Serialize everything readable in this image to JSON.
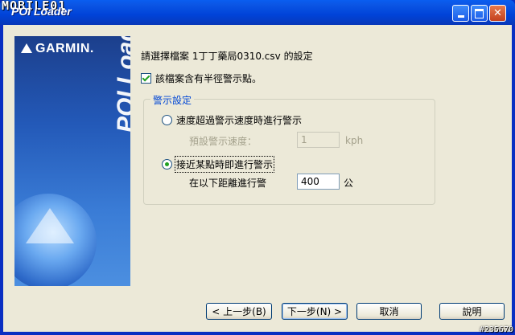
{
  "window": {
    "title": "POI Loader",
    "brand_watermark": "MOBILE01",
    "id_watermark": "#235670"
  },
  "banner": {
    "logo_text": "GARMIN.",
    "vertical_title": "POI Loader"
  },
  "main": {
    "prompt": "請選擇檔案 1丁丁藥局0310.csv 的設定",
    "radius_checkbox": {
      "label": "該檔案含有半徑警示點。",
      "checked": true
    },
    "alert_group": {
      "title": "警示設定",
      "speed_option": {
        "label": "速度超過警示速度時進行警示",
        "selected": false
      },
      "default_speed_label": "預設警示速度：",
      "default_speed_value": "1",
      "speed_unit": "kph",
      "proximity_option": {
        "label": "接近某點時即進行警示",
        "selected": true
      },
      "distance_label": "在以下距離進行警",
      "distance_value": "400",
      "distance_unit": "公"
    }
  },
  "buttons": {
    "back": "< 上一步(B)",
    "next": "下一步(N) >",
    "cancel": "取消",
    "help": "說明"
  },
  "colors": {
    "title_bar": "#0a54e4",
    "dialog_bg": "#ece9d8",
    "group_title": "#0046d5",
    "check_mark": "#21a121"
  }
}
